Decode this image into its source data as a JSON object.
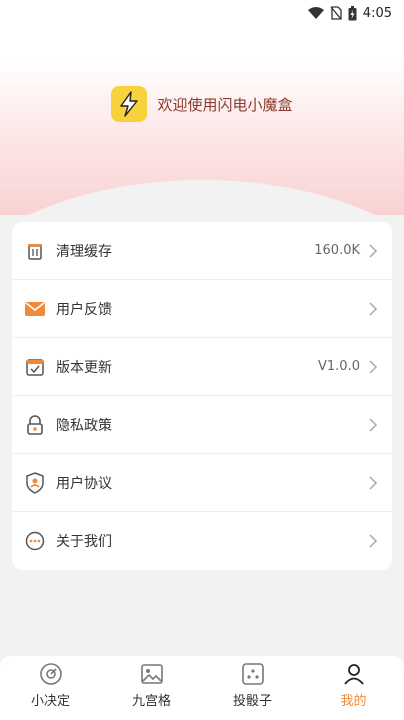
{
  "status_bar": {
    "time": "4:05"
  },
  "header": {
    "welcome": "欢迎使用闪电小魔盒"
  },
  "menu": [
    {
      "label": "清理缓存",
      "value": "160.0K",
      "icon": "trash-icon"
    },
    {
      "label": "用户反馈",
      "value": "",
      "icon": "mail-icon"
    },
    {
      "label": "版本更新",
      "value": "V1.0.0",
      "icon": "calendar-check-icon"
    },
    {
      "label": "隐私政策",
      "value": "",
      "icon": "lock-icon"
    },
    {
      "label": "用户协议",
      "value": "",
      "icon": "shield-user-icon"
    },
    {
      "label": "关于我们",
      "value": "",
      "icon": "more-circle-icon"
    }
  ],
  "tabs": [
    {
      "label": "小决定",
      "icon": "target-icon"
    },
    {
      "label": "九宫格",
      "icon": "image-icon"
    },
    {
      "label": "投骰子",
      "icon": "dice-icon"
    },
    {
      "label": "我的",
      "icon": "user-icon"
    }
  ],
  "colors": {
    "accent": "#f08a3a",
    "logo": "#f7d23b",
    "welcome_text": "#8a3a2c"
  }
}
